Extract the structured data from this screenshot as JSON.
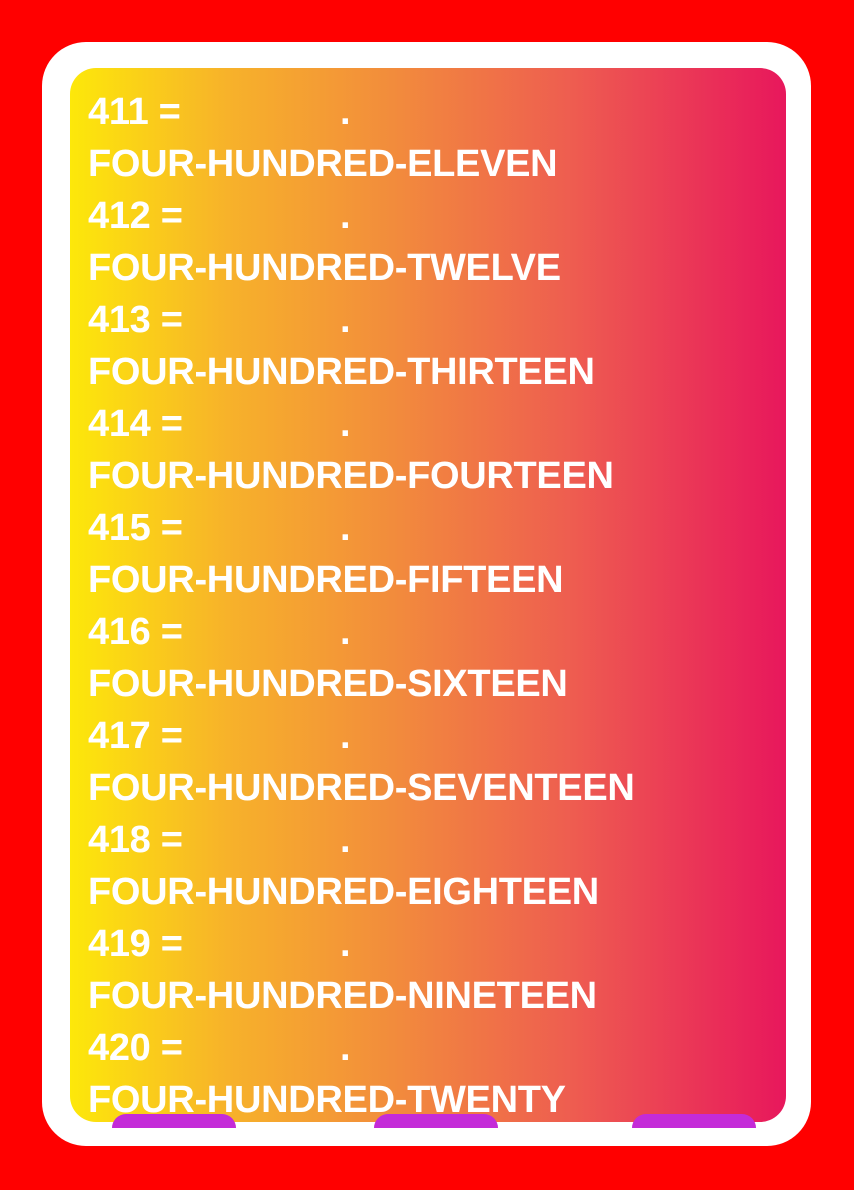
{
  "entries": [
    {
      "number": "411 =",
      "separator": ".",
      "words": "FOUR-HUNDRED-ELEVEN"
    },
    {
      "number": "412 =",
      "separator": ".",
      "words": "FOUR-HUNDRED-TWELVE"
    },
    {
      "number": "413 =",
      "separator": ".",
      "words": "FOUR-HUNDRED-THIRTEEN"
    },
    {
      "number": "414 =",
      "separator": ".",
      "words": "FOUR-HUNDRED-FOURTEEN"
    },
    {
      "number": "415 =",
      "separator": ".",
      "words": "FOUR-HUNDRED-FIFTEEN"
    },
    {
      "number": "416 =",
      "separator": ".",
      "words": "FOUR-HUNDRED-SIXTEEN"
    },
    {
      "number": "417 =",
      "separator": ".",
      "words": "FOUR-HUNDRED-SEVENTEEN"
    },
    {
      "number": "418 =",
      "separator": ".",
      "words": "FOUR-HUNDRED-EIGHTEEN"
    },
    {
      "number": "419 =",
      "separator": ".",
      "words": "FOUR-HUNDRED-NINETEEN"
    },
    {
      "number": "420 =",
      "separator": ".",
      "words": "FOUR-HUNDRED-TWENTY"
    }
  ],
  "colors": {
    "background": "#ff0000",
    "frame": "#ffffff",
    "gradient_start": "#fde80a",
    "gradient_end": "#e8175c",
    "text": "#ffffff",
    "tab_accent": "#c42bd8"
  }
}
